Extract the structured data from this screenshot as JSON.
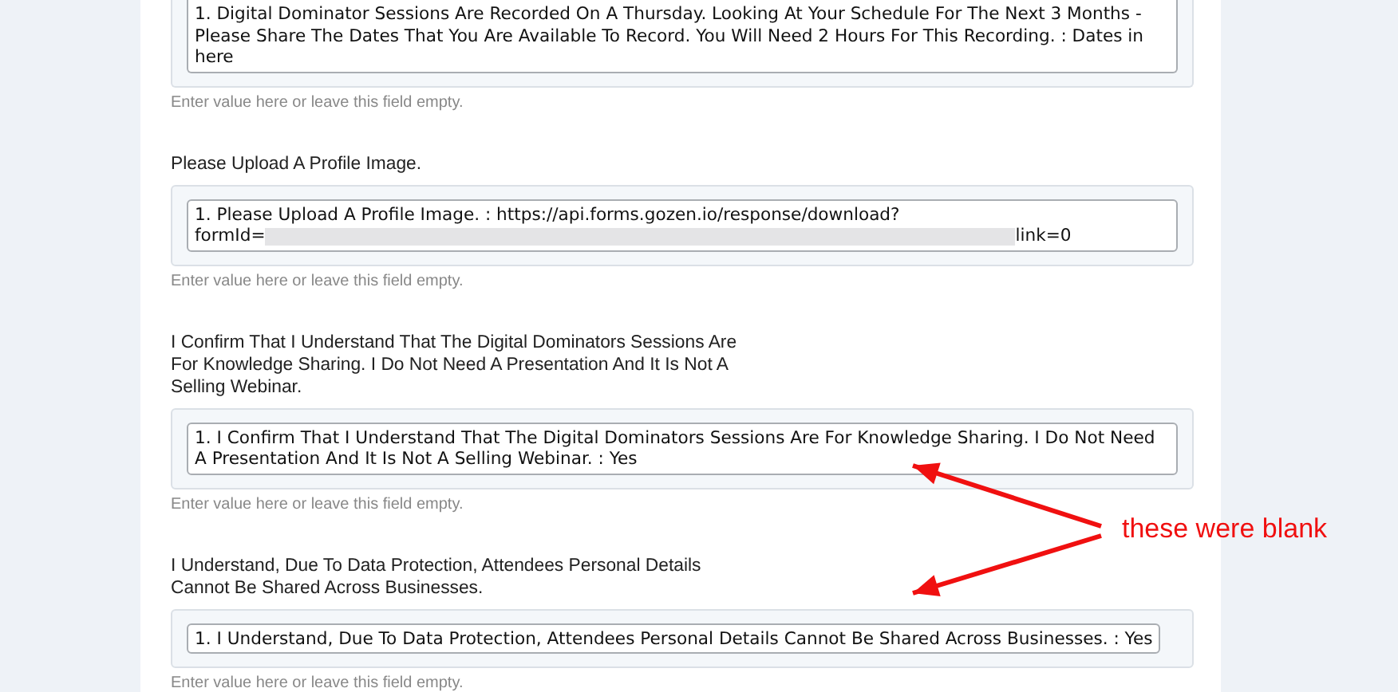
{
  "fields": [
    {
      "kind": "textarea",
      "cut_top": true,
      "value": "1. Digital Dominator Sessions Are Recorded On A Thursday. Looking At Your Schedule For The Next 3 Months - Please Share The Dates That You Are Available To Record. You Will Need 2 Hours For This Recording. : Dates in here",
      "hint": "Enter value here or leave this field empty."
    },
    {
      "label": "Please Upload A Profile Image.",
      "kind": "textarea",
      "cut_top": false,
      "value": "1. Please Upload A Profile Image. : https://api.forms.gozen.io/response/download?",
      "value_line2": "formId=",
      "redacted": true,
      "value_tail": "link=0",
      "hint": "Enter value here or leave this field empty."
    },
    {
      "label": "I Confirm That I Understand That The Digital Dominators Sessions Are For Knowledge Sharing. I Do Not Need A Presentation And It Is Not A Selling Webinar.",
      "kind": "textarea",
      "cut_top": false,
      "value": "1. I Confirm That I Understand That The Digital Dominators Sessions Are For Knowledge Sharing. I Do Not Need A Presentation And It Is Not A Selling Webinar. : Yes",
      "hint": "Enter value here or leave this field empty."
    },
    {
      "label": "I Understand, Due To Data Protection, Attendees Personal Details Cannot Be Shared Across Businesses.",
      "kind": "input",
      "cut_top": false,
      "value": "1. I Understand, Due To Data Protection, Attendees Personal Details Cannot Be Shared Across Businesses. : Yes",
      "hint": "Enter value here or leave this field empty."
    }
  ],
  "annotation": {
    "text": "these were blank"
  }
}
